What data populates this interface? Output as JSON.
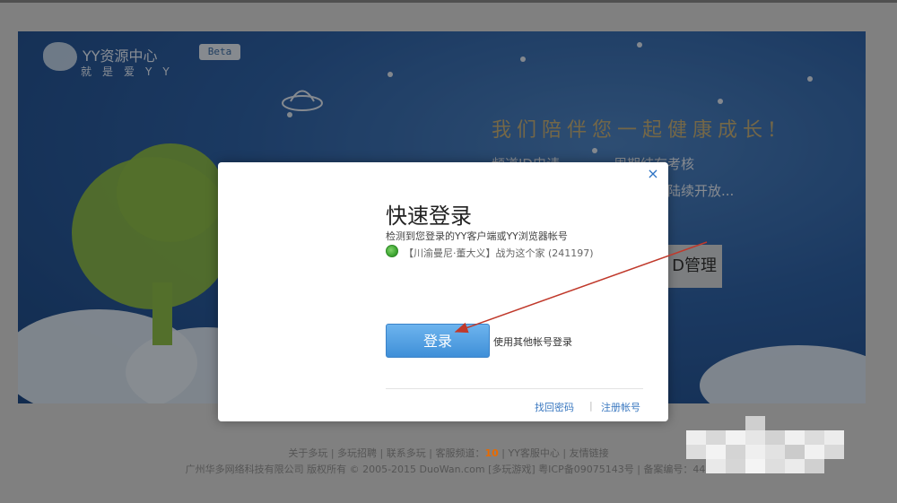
{
  "hero": {
    "logo_title": "YY资源中心",
    "logo_sub": "就是爱YY",
    "beta": "Beta",
    "tagline": "我们陪伴您一起健康成长!",
    "links": [
      "频道ID申请",
      "周期结存考核",
      "陆续开放..."
    ],
    "manage_button": "D管理"
  },
  "modal": {
    "title": "快速登录",
    "description": "检测到您登录的YY客户端或YY浏览器帐号",
    "account_label": "【川渝曼尼·董大义】战为这个家 (241197)",
    "login_button": "登录",
    "other_login": "使用其他帐号登录",
    "close": "×",
    "find_password": "找回密码",
    "separator": "|",
    "register": "注册帐号"
  },
  "footer": {
    "line1_pre": "关于多玩 | 多玩招聘 | 联系多玩 | 客服频道：",
    "line1_channel": "10",
    "line1_post": " | YY客服中心 | 友情链接",
    "line2": "广州华多网络科技有限公司 版权所有 © 2005-2015 DuoWan.com [多玩游戏] 粤ICP备09075143号 | 备案编号：440"
  },
  "colors": {
    "hero_bg": "#2f63a8",
    "login_button": "#4a97dc",
    "link": "#3a78c0",
    "arrow": "#c0392b",
    "tagline": "#c9b27a"
  }
}
